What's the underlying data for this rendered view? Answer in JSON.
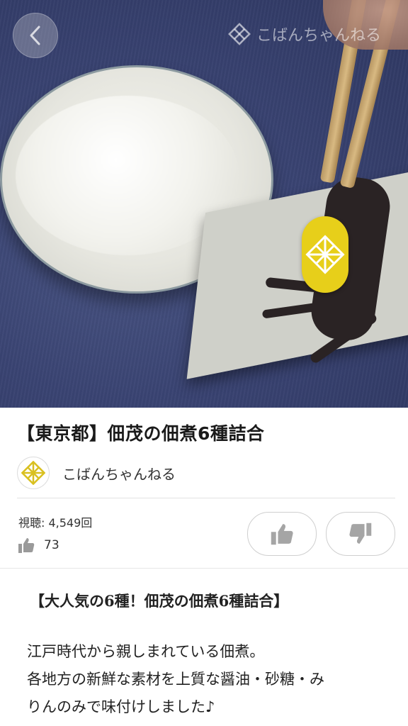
{
  "video": {
    "channel_watermark": "こばんちゃんねる",
    "back_icon": "chevron-left-icon",
    "logo_icon": "diamond-lattice-icon",
    "fab_color": "#e7cf1a"
  },
  "title": "【東京都】佃茂の佃煮6種詰合",
  "channel": {
    "name": "こばんちゃんねる",
    "avatar_icon": "diamond-lattice-icon"
  },
  "stats": {
    "views": "視聴: 4,549回",
    "likes_count": "73",
    "like_icon": "thumbs-up-icon",
    "dislike_icon": "thumbs-down-icon"
  },
  "description": {
    "heading": "【大人気の6種！佃茂の佃煮6種詰合】",
    "lines": [
      "江戸時代から親しまれている佃煮。",
      "各地方の新鮮な素材を上質な醤油・砂糖・み",
      "りんのみで味付けしました♪"
    ]
  },
  "colors": {
    "accent": "#e7cf1a",
    "text": "#222222",
    "button_border": "#cfcfcf"
  }
}
